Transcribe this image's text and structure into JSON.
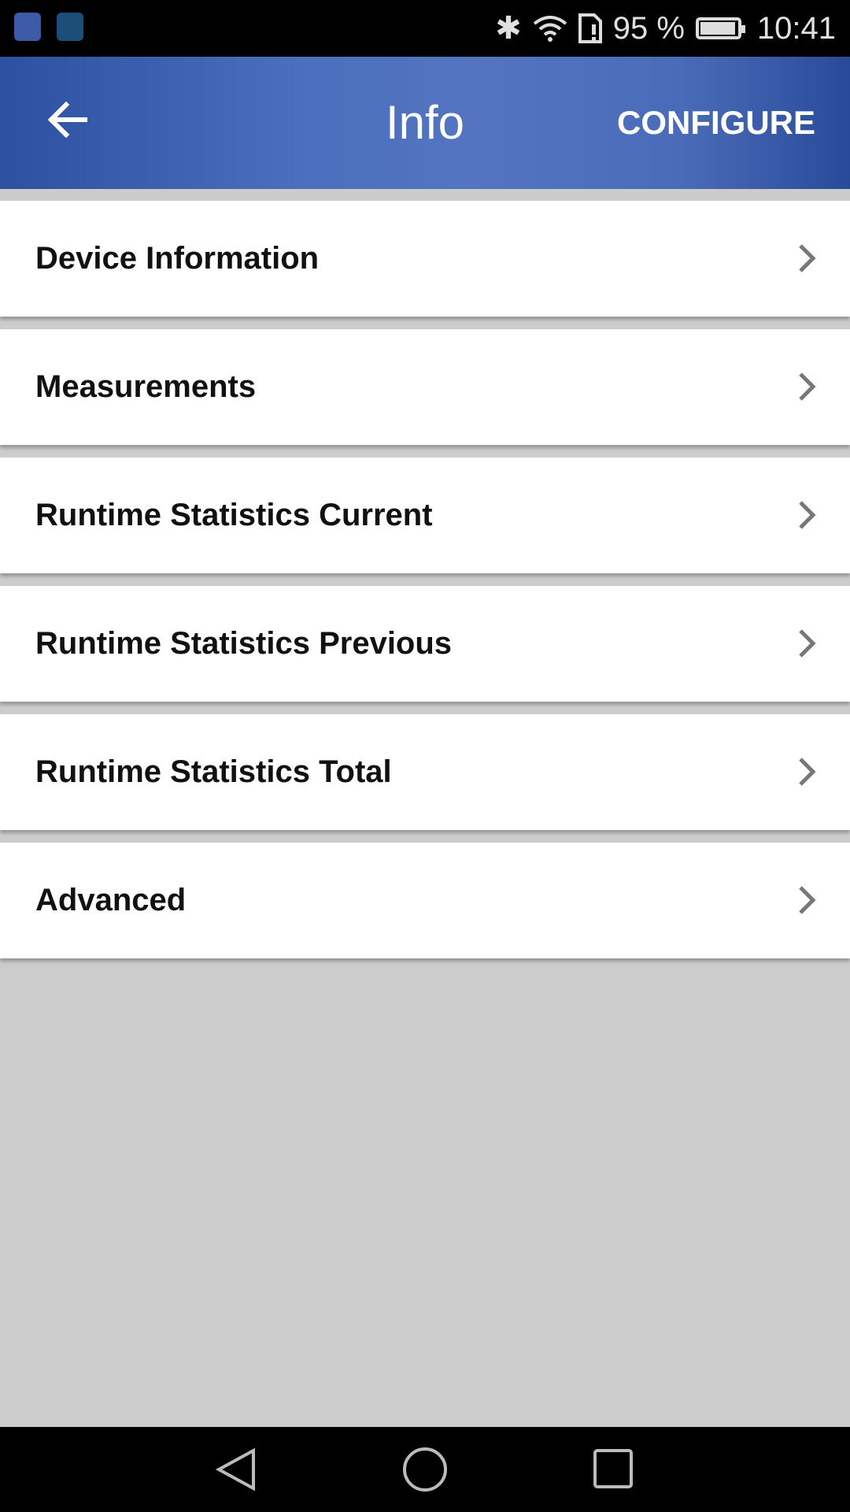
{
  "status_bar": {
    "battery_percent": "95 %",
    "time": "10:41",
    "icons": [
      "location-app-icon",
      "app-icon",
      "bluetooth-icon",
      "wifi-icon",
      "sim-alert-icon",
      "battery-icon"
    ]
  },
  "header": {
    "title": "Info",
    "configure_label": "CONFIGURE",
    "background_color": "#4a6fbc"
  },
  "menu": {
    "items": [
      {
        "label": "Device Information"
      },
      {
        "label": "Measurements"
      },
      {
        "label": "Runtime Statistics Current"
      },
      {
        "label": "Runtime Statistics Previous"
      },
      {
        "label": "Runtime Statistics Total"
      },
      {
        "label": "Advanced"
      }
    ]
  }
}
